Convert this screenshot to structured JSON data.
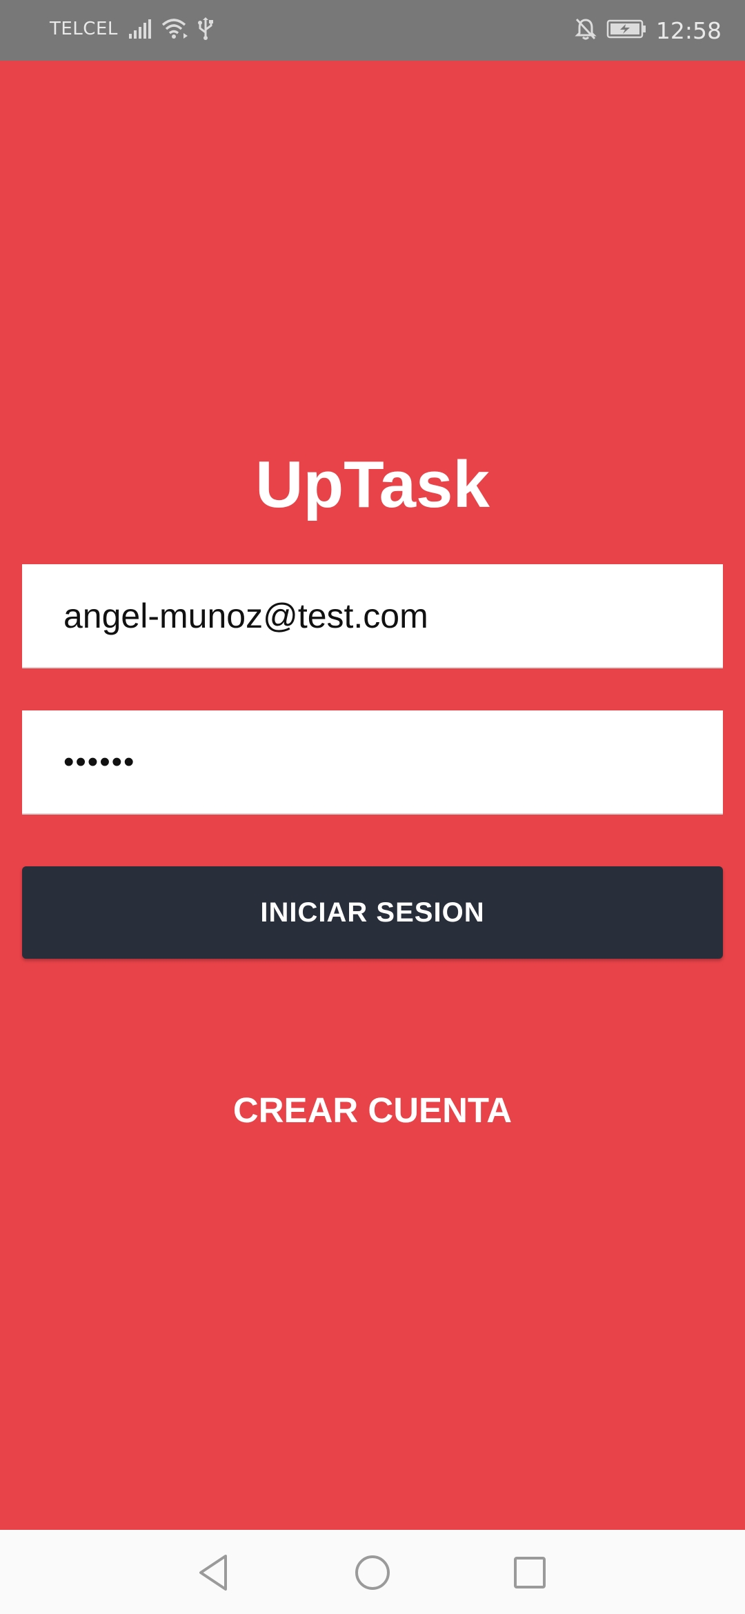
{
  "status_bar": {
    "carrier": "TELCEL",
    "time": "12:58",
    "icons": [
      "signal-icon",
      "wifi-icon",
      "usb-icon",
      "notifications-off-icon",
      "battery-charging-icon"
    ]
  },
  "app": {
    "title": "UpTask"
  },
  "login_form": {
    "email_value": "angel-munoz@test.com",
    "password_value": "••••••",
    "login_button_label": "INICIAR SESION",
    "create_account_label": "CREAR CUENTA"
  },
  "nav_bar": {
    "icons": [
      "back-icon",
      "home-icon",
      "recents-icon"
    ]
  },
  "colors": {
    "background": "#e84349",
    "button": "#282e3a",
    "status_bar": "#787878",
    "nav_bar": "#fafafa"
  }
}
